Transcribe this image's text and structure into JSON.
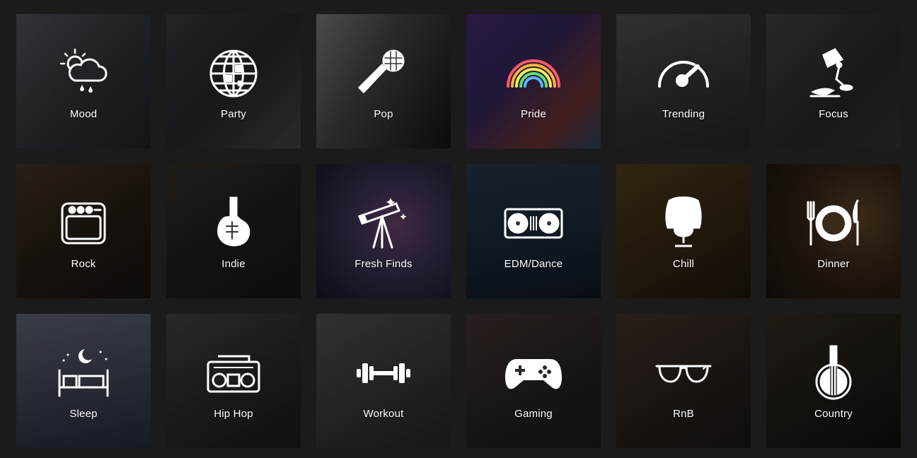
{
  "categories": [
    {
      "label": "Mood",
      "icon": "weather-mood-icon",
      "bg": "linear-gradient(135deg,#5a6168 0%,#3a3f44 45%,#23262a 100%)"
    },
    {
      "label": "Party",
      "icon": "disco-ball-icon",
      "bg": "linear-gradient(135deg,#3e4146 0%,#2a2c30 50%,#4a4c50 100%)"
    },
    {
      "label": "Pop",
      "icon": "microphone-icon",
      "bg": "linear-gradient(120deg,#8a8a8a 0%,#4e4e4e 40%,#151515 100%)"
    },
    {
      "label": "Pride",
      "icon": "rainbow-icon",
      "bg": "linear-gradient(135deg,#4a2f7a 0%,#3b2a66 40%,#7a3a3a 75%,#2f4a6a 100%)"
    },
    {
      "label": "Trending",
      "icon": "speedometer-icon",
      "bg": "linear-gradient(160deg,#5a5a5a 0%,#3d3d3d 50%,#2a2a2a 100%)"
    },
    {
      "label": "Focus",
      "icon": "desk-lamp-icon",
      "bg": "linear-gradient(135deg,#4a4a4a 0%,#2c2c2c 60%,#3a3a3a 100%)"
    },
    {
      "label": "Rock",
      "icon": "amplifier-icon",
      "bg": "linear-gradient(150deg,#4a3a2a 0%,#2a2018 55%,#1a1410 100%)"
    },
    {
      "label": "Indie",
      "icon": "electric-guitar-icon",
      "bg": "linear-gradient(150deg,#3a3530 0%,#24211e 55%,#1a1816 100%)"
    },
    {
      "label": "Fresh Finds",
      "icon": "telescope-icon",
      "bg": "radial-gradient(circle at 60% 45%,#7a4a7a 0%,#4a3a66 35%,#2a2a44 70%,#1a1a28 100%)"
    },
    {
      "label": "EDM/Dance",
      "icon": "dj-turntable-icon",
      "bg": "linear-gradient(170deg,#2a3e55 0%,#1e2e40 55%,#121a24 100%)"
    },
    {
      "label": "Chill",
      "icon": "egg-chair-icon",
      "bg": "linear-gradient(150deg,#5a4420 0%,#3a2c16 55%,#20180c 100%)"
    },
    {
      "label": "Dinner",
      "icon": "dinner-plate-icon",
      "bg": "radial-gradient(circle at 70% 40%,#6a4a2a 0%,#3a2a1a 45%,#1a140e 100%)"
    },
    {
      "label": "Sleep",
      "icon": "bed-moon-icon",
      "bg": "linear-gradient(170deg,#6a7080 0%,#4a5060 50%,#2a3040 100%)"
    },
    {
      "label": "Hip Hop",
      "icon": "boombox-icon",
      "bg": "linear-gradient(150deg,#4a4a4a 0%,#2e2e2e 55%,#1e1e1e 100%)"
    },
    {
      "label": "Workout",
      "icon": "dumbbell-icon",
      "bg": "linear-gradient(150deg,#5a5a5a 0%,#3e3e3e 55%,#2a2a2a 100%)"
    },
    {
      "label": "Gaming",
      "icon": "gamepad-icon",
      "bg": "linear-gradient(150deg,#4a3a36 0%,#2c2826 55%,#1e1c1c 100%)"
    },
    {
      "label": "RnB",
      "icon": "sunglasses-icon",
      "bg": "linear-gradient(150deg,#4a3a30 0%,#302620 55%,#1e1814 100%)"
    },
    {
      "label": "Country",
      "icon": "banjo-icon",
      "bg": "linear-gradient(150deg,#3a3026 0%,#241e18 55%,#14100c 100%)"
    }
  ]
}
